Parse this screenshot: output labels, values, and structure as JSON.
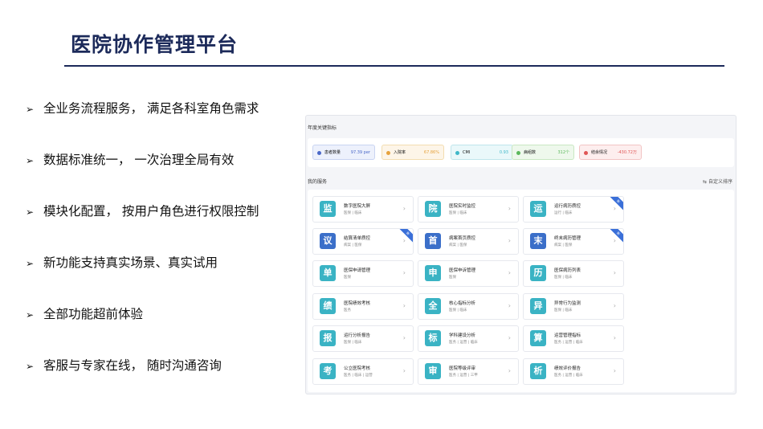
{
  "title": "医院协作管理平台",
  "bullets": [
    "全业务流程服务， 满足各科室角色需求",
    "数据标准统一， 一次治理全局有效",
    "模块化配置， 按用户角色进行权限控制",
    "新功能支持真实场景、真实试用",
    "全部功能超前体验",
    "客服与专家在线， 随时沟通咨询"
  ],
  "screen": {
    "kpi_heading": "年度关键指标",
    "kpis": [
      {
        "label": "患者数量",
        "value": "97.39 per",
        "color": "#4a68c8",
        "bg": "#edf1fc",
        "border": "#c9d4f2"
      },
      {
        "label": "入院率",
        "value": "67.86%",
        "color": "#e6a23c",
        "bg": "#fdf5e8",
        "border": "#f3ddb0"
      },
      {
        "label": "CMI",
        "value": "0.93",
        "color": "#3fb8c9",
        "bg": "#eaf8fa",
        "border": "#bfe6ec"
      },
      {
        "label": "病组数",
        "value": "312个",
        "color": "#5bb85b",
        "bg": "#eef8ec",
        "border": "#c8e7c2"
      },
      {
        "label": "结余情况",
        "value": "-430.72万",
        "color": "#e05656",
        "bg": "#fdeeee",
        "border": "#f2c4c4"
      }
    ],
    "services_heading": "我的服务",
    "custom_sort_label": "自定义排序",
    "services": [
      {
        "icon": "监",
        "name": "数字医院大屏",
        "tags": "医保 | 临床",
        "color": "#3ab3c4",
        "ribbon": false
      },
      {
        "icon": "院",
        "name": "医院实时监控",
        "tags": "医保 | 临床",
        "color": "#3ab3c4",
        "ribbon": false
      },
      {
        "icon": "运",
        "name": "运行病历质控",
        "tags": "运行 | 临床",
        "color": "#3ab3c4",
        "ribbon": true
      },
      {
        "icon": "议",
        "name": "结算清单质控",
        "tags": "病案 | 医保",
        "color": "#3b6fc9",
        "ribbon": true
      },
      {
        "icon": "首",
        "name": "病案首页质控",
        "tags": "病案 | 医保",
        "color": "#3b6fc9",
        "ribbon": false
      },
      {
        "icon": "末",
        "name": "终末病历管理",
        "tags": "病案 | 医保",
        "color": "#3b6fc9",
        "ribbon": true
      },
      {
        "icon": "单",
        "name": "医保申请管理",
        "tags": "医保",
        "color": "#3ab3c4",
        "ribbon": false
      },
      {
        "icon": "申",
        "name": "医保申诉管理",
        "tags": "医保",
        "color": "#3ab3c4",
        "ribbon": false
      },
      {
        "icon": "历",
        "name": "医保病历列表",
        "tags": "医保 | 临床",
        "color": "#3ab3c4",
        "ribbon": false
      },
      {
        "icon": "绩",
        "name": "医院绩效考核",
        "tags": "医务",
        "color": "#3ab3c4",
        "ribbon": false
      },
      {
        "icon": "全",
        "name": "核心指标分析",
        "tags": "医保 | 临床",
        "color": "#3ab3c4",
        "ribbon": false
      },
      {
        "icon": "异",
        "name": "异常行为监测",
        "tags": "医保 | 临床",
        "color": "#3ab3c4",
        "ribbon": false
      },
      {
        "icon": "报",
        "name": "运行分析报告",
        "tags": "医保 | 临床",
        "color": "#3ab3c4",
        "ribbon": false
      },
      {
        "icon": "标",
        "name": "学科建设分析",
        "tags": "医务 | 运营 | 临床",
        "color": "#3ab3c4",
        "ribbon": false
      },
      {
        "icon": "算",
        "name": "运营管理指标",
        "tags": "医务 | 运营 | 临床",
        "color": "#3ab3c4",
        "ribbon": false
      },
      {
        "icon": "考",
        "name": "公立医院考核",
        "tags": "医务 | 临床 | 运营",
        "color": "#3ab3c4",
        "ribbon": false
      },
      {
        "icon": "审",
        "name": "医院等级评审",
        "tags": "医务 | 运营 | 三甲",
        "color": "#3ab3c4",
        "ribbon": false
      },
      {
        "icon": "析",
        "name": "绩效评价报告",
        "tags": "医务 | 运营 | 临床",
        "color": "#3ab3c4",
        "ribbon": false
      }
    ],
    "ribbon_text": "新",
    "chevron": "›"
  }
}
